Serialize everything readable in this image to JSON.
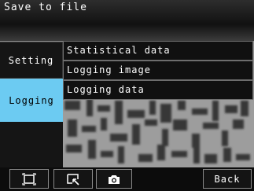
{
  "window": {
    "title": "Save to file"
  },
  "left_menu": {
    "items": [
      {
        "label": "Setting",
        "selected": false
      },
      {
        "label": "Logging",
        "selected": true
      }
    ]
  },
  "submenu": {
    "items": [
      {
        "label": "Statistical data"
      },
      {
        "label": "Logging image"
      },
      {
        "label": "Logging data"
      }
    ]
  },
  "toolbar": {
    "fit_icon": "fit-screen-icon",
    "zoom_icon": "zoom-area-icon",
    "capture_icon": "camera-icon",
    "back_label": "Back"
  },
  "colors": {
    "selected_menu": "#6ccbf2",
    "panel": "#101010",
    "border": "#6d6d6d"
  }
}
